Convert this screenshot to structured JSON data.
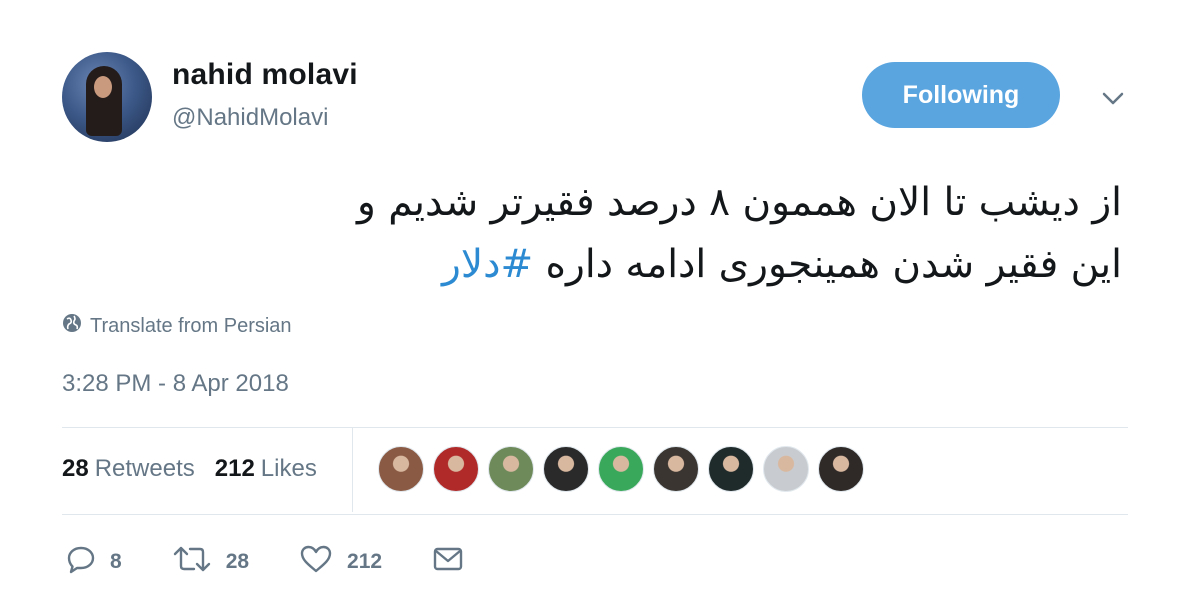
{
  "user": {
    "display_name": "nahid molavi",
    "handle": "@NahidMolavi",
    "avatar_icon": "profile-photo"
  },
  "header": {
    "follow_button_label": "Following",
    "menu_icon": "chevron-down-icon",
    "accent_color": "#5aa5e0"
  },
  "tweet": {
    "text_line1": "از دیشب تا الان هممون ۸ درصد فقیرتر شدیم و",
    "text_line2": "این فقیر شدن همینجوری ادامه داره",
    "hashtag": "#دلار",
    "hashtag_color": "#2b8ad1"
  },
  "translate": {
    "label": "Translate from Persian",
    "icon": "globe-icon"
  },
  "timestamp": "3:28 PM - 8 Apr 2018",
  "stats": {
    "retweets_count": "28",
    "retweets_label": "Retweets",
    "likes_count": "212",
    "likes_label": "Likes"
  },
  "likers": [
    {
      "name": "liker-avatar-1",
      "color": "#8a5a44"
    },
    {
      "name": "liker-avatar-2",
      "color": "#b02a2a"
    },
    {
      "name": "liker-avatar-3",
      "color": "#6e8a5a"
    },
    {
      "name": "liker-avatar-4",
      "color": "#2a2a2a"
    },
    {
      "name": "liker-avatar-5",
      "color": "#3aa85a"
    },
    {
      "name": "liker-avatar-6",
      "color": "#3a3530"
    },
    {
      "name": "liker-avatar-7",
      "color": "#1f2a2a"
    },
    {
      "name": "liker-avatar-8",
      "color": "#c8ccd0"
    },
    {
      "name": "liker-avatar-9",
      "color": "#2f2a28"
    }
  ],
  "actions": {
    "reply_count": "8",
    "retweet_count": "28",
    "like_count": "212"
  }
}
